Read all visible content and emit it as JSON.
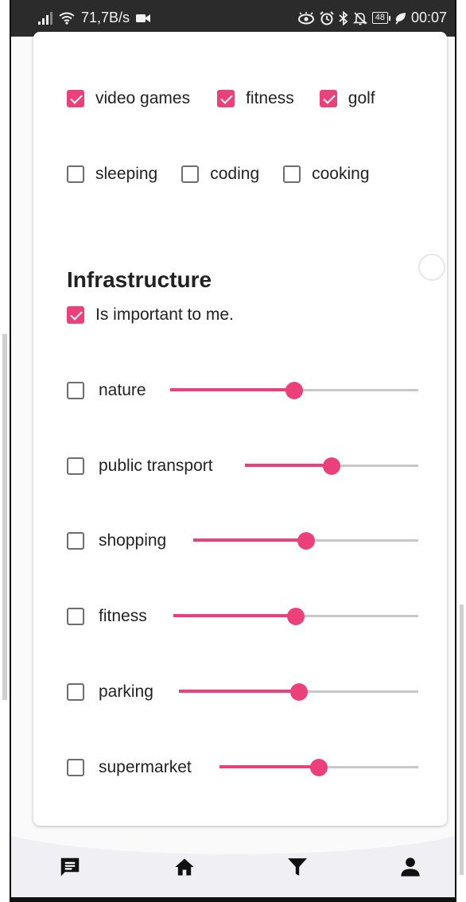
{
  "status_bar": {
    "speed": "71,7B/s",
    "battery": "48",
    "time": "00:07",
    "icons": [
      "signal-icon",
      "wifi-icon",
      "video-camera-icon",
      "eye-icon",
      "alarm-icon",
      "bluetooth-icon",
      "mute-icon",
      "battery-icon",
      "leaf-icon"
    ]
  },
  "hobbies": [
    {
      "label": "video games",
      "checked": true
    },
    {
      "label": "fitness",
      "checked": true
    },
    {
      "label": "golf",
      "checked": true
    },
    {
      "label": "sleeping",
      "checked": false
    },
    {
      "label": "coding",
      "checked": false
    },
    {
      "label": "cooking",
      "checked": false
    }
  ],
  "infrastructure": {
    "title": "Infrastructure",
    "important_label": "Is important to me.",
    "important_checked": true,
    "items": [
      {
        "label": "nature",
        "checked": false,
        "value": 0.5
      },
      {
        "label": "public transport",
        "checked": false,
        "value": 0.5
      },
      {
        "label": "shopping",
        "checked": false,
        "value": 0.5
      },
      {
        "label": "fitness",
        "checked": false,
        "value": 0.5
      },
      {
        "label": "parking",
        "checked": false,
        "value": 0.5
      },
      {
        "label": "supermarket",
        "checked": false,
        "value": 0.5
      }
    ]
  },
  "bottom_nav": {
    "items": [
      {
        "icon": "chat-icon",
        "active": true
      },
      {
        "icon": "home-icon",
        "active": false
      },
      {
        "icon": "filter-icon",
        "active": false
      },
      {
        "icon": "person-icon",
        "active": false
      }
    ]
  },
  "colors": {
    "accent": "#ec407a",
    "status_bar": "#2b2b2b",
    "text": "#222222"
  }
}
